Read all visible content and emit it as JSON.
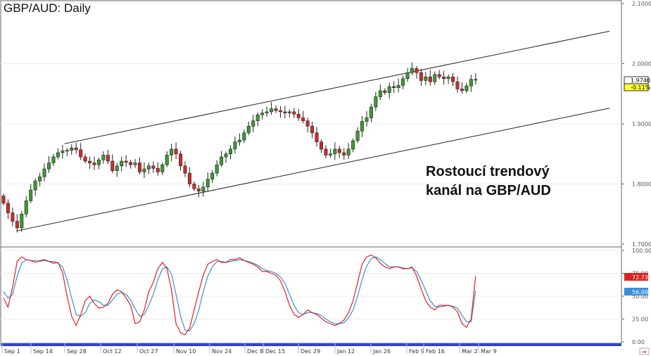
{
  "chart_data": {
    "type": "candlestick",
    "title": "GBP/AUD: Daily",
    "annotation": [
      "Rostoucí trendový",
      "kanál na GBP/AUD"
    ],
    "price_axis": {
      "ylim": [
        1.7,
        2.1
      ],
      "ticks": [
        "2.1000",
        "2.0000",
        "1.9000",
        "1.8000",
        "1.7000"
      ]
    },
    "last_price": "1.9740",
    "change": "-0.11%",
    "stoch_axis": {
      "ylim": [
        0,
        100
      ],
      "ticks": [
        "100.00",
        "75.00",
        "50.00",
        "25.00",
        "0.00"
      ]
    },
    "stoch_badges": [
      "72.73",
      "56.09"
    ],
    "date_labels": [
      "Sep 1",
      "Sep 14",
      "Sep 28",
      "Oct 12",
      "Oct 27",
      "Nov 10",
      "Nov 24",
      "Dec 8",
      "Dec 15",
      "Dec 29",
      "Jan 12",
      "Jan 26",
      "Feb 9",
      "Feb 16",
      "Mar 2",
      "Mar 9"
    ],
    "close": [
      1.768,
      1.752,
      1.738,
      1.727,
      1.75,
      1.772,
      1.79,
      1.805,
      1.812,
      1.825,
      1.835,
      1.845,
      1.852,
      1.855,
      1.856,
      1.86,
      1.857,
      1.845,
      1.838,
      1.835,
      1.832,
      1.84,
      1.848,
      1.838,
      1.822,
      1.83,
      1.838,
      1.836,
      1.832,
      1.835,
      1.82,
      1.825,
      1.83,
      1.826,
      1.82,
      1.832,
      1.848,
      1.858,
      1.85,
      1.83,
      1.818,
      1.8,
      1.792,
      1.788,
      1.795,
      1.808,
      1.818,
      1.832,
      1.845,
      1.85,
      1.858,
      1.87,
      1.873,
      1.885,
      1.896,
      1.905,
      1.915,
      1.918,
      1.92,
      1.925,
      1.922,
      1.92,
      1.918,
      1.92,
      1.916,
      1.91,
      1.905,
      1.896,
      1.885,
      1.87,
      1.858,
      1.848,
      1.85,
      1.858,
      1.852,
      1.848,
      1.858,
      1.872,
      1.888,
      1.904,
      1.91,
      1.928,
      1.945,
      1.955,
      1.952,
      1.962,
      1.96,
      1.964,
      1.975,
      1.985,
      1.992,
      1.985,
      1.972,
      1.978,
      1.97,
      1.982,
      1.978,
      1.975,
      1.978,
      1.97,
      1.958,
      1.955,
      1.963,
      1.974,
      1.974
    ],
    "channel": {
      "upper": [
        [
          8,
          1.867
        ],
        [
          103,
          2.054
        ]
      ],
      "lower": [
        [
          3,
          1.722
        ],
        [
          103,
          1.926
        ]
      ]
    },
    "stoch_k": [
      48,
      38,
      60,
      88,
      93,
      90,
      89,
      87,
      89,
      90,
      88,
      86,
      87,
      76,
      50,
      28,
      18,
      30,
      45,
      50,
      42,
      37,
      38,
      42,
      52,
      57,
      55,
      48,
      40,
      20,
      22,
      35,
      55,
      65,
      80,
      87,
      80,
      57,
      20,
      10,
      8,
      15,
      35,
      55,
      73,
      85,
      88,
      90,
      87,
      87,
      90,
      90,
      92,
      89,
      87,
      85,
      82,
      77,
      77,
      75,
      73,
      67,
      55,
      40,
      30,
      27,
      30,
      35,
      32,
      30,
      26,
      22,
      20,
      18,
      20,
      24,
      32,
      45,
      65,
      85,
      93,
      95,
      92,
      86,
      82,
      80,
      82,
      82,
      80,
      80,
      82,
      72,
      58,
      45,
      38,
      35,
      40,
      40,
      40,
      38,
      33,
      20,
      16,
      25,
      72
    ],
    "stoch_d": [
      55,
      48,
      52,
      72,
      86,
      90,
      89,
      89,
      88,
      89,
      88,
      88,
      86,
      82,
      68,
      48,
      30,
      28,
      32,
      42,
      46,
      44,
      40,
      40,
      46,
      52,
      54,
      52,
      46,
      36,
      28,
      30,
      40,
      52,
      68,
      80,
      82,
      74,
      52,
      28,
      13,
      12,
      20,
      35,
      55,
      72,
      82,
      88,
      88,
      87,
      88,
      89,
      90,
      89,
      88,
      86,
      84,
      80,
      78,
      77,
      75,
      71,
      64,
      52,
      40,
      32,
      30,
      32,
      32,
      31,
      29,
      25,
      22,
      20,
      20,
      21,
      26,
      35,
      50,
      68,
      83,
      91,
      93,
      90,
      86,
      82,
      82,
      82,
      81,
      80,
      81,
      77,
      68,
      56,
      45,
      39,
      38,
      39,
      40,
      39,
      37,
      29,
      22,
      22,
      56
    ],
    "colors": {
      "up": "#3a9b2e",
      "down": "#d42a2a",
      "stoch_k": "#e02020",
      "stoch_d": "#3a8fd8",
      "channel": "#222222",
      "date_bar": "#3344cc"
    }
  }
}
